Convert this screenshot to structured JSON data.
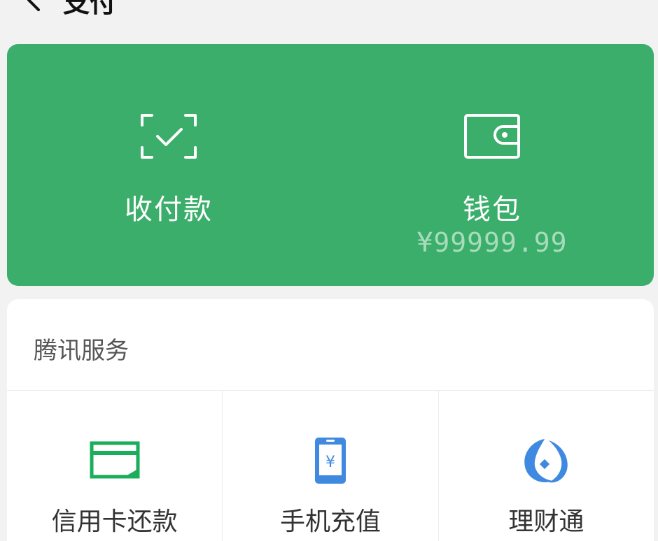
{
  "header": {
    "title": "支付"
  },
  "top_actions": [
    {
      "label": "收付款"
    },
    {
      "label": "钱包",
      "sub": "¥99999.99"
    }
  ],
  "services": {
    "title": "腾讯服务",
    "items": [
      {
        "label": "信用卡还款",
        "icon": "credit-card-icon"
      },
      {
        "label": "手机充值",
        "icon": "phone-recharge-icon"
      },
      {
        "label": "理财通",
        "icon": "wealth-icon"
      }
    ]
  },
  "colors": {
    "green": "#3aae6a",
    "card_bg": "#ffffff",
    "page_bg": "#f2f2f2",
    "blue": "#3f8ae0",
    "credit_green": "#1aad5b"
  }
}
